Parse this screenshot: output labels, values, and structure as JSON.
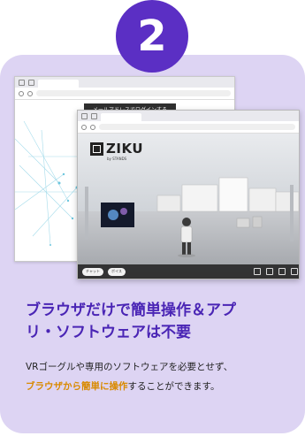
{
  "step_number": "2",
  "back_window": {
    "login_banner": "メールアドレスでログインする"
  },
  "front_window": {
    "logo_text": "ZIKU",
    "logo_subtext": "by STANDS",
    "chat_button": "チャット",
    "voice_button": "ボイス"
  },
  "heading_line1": "ブラウザだけで簡単操作＆アプ",
  "heading_line2": "リ・ソフトウェアは不要",
  "description": {
    "line1": "VRゴーグルや専用のソフトウェアを必要とせず、",
    "highlight": "ブラウザから簡単に操作",
    "line2_rest": "することができます。"
  },
  "colors": {
    "accent": "#5b2fc4",
    "heading": "#4a25b5",
    "highlight": "#d98a00",
    "card_bg": "#ddd4f3"
  }
}
